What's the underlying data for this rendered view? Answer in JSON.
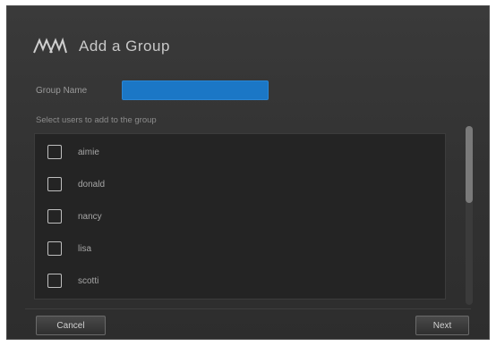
{
  "dialog": {
    "logo_icon": "wd-logo",
    "title": "Add a Group"
  },
  "form": {
    "group_name_label": "Group Name",
    "group_name_value": "",
    "hint": "Select users to add to the group"
  },
  "users": [
    {
      "name": "aimie",
      "checked": false
    },
    {
      "name": "donald",
      "checked": false
    },
    {
      "name": "nancy",
      "checked": false
    },
    {
      "name": "lisa",
      "checked": false
    },
    {
      "name": "scotti",
      "checked": false
    }
  ],
  "buttons": {
    "cancel": "Cancel",
    "next": "Next"
  },
  "colors": {
    "input_accent": "#1b77c6",
    "dialog_bg": "#333333",
    "list_bg": "#242424"
  }
}
